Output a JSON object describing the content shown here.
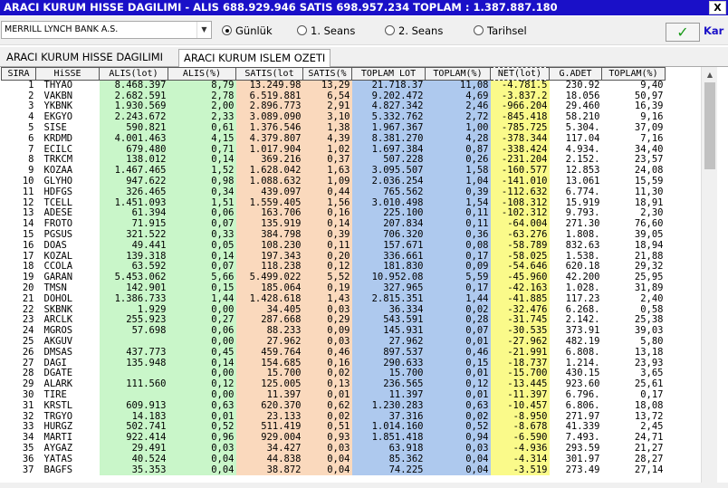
{
  "window": {
    "title": "ARACI KURUM HISSE DAGILIMI - ALIS 688.929.946  SATIS 698.957.234  TOPLAM : 1.387.887.180",
    "close_label": "X"
  },
  "toolbar": {
    "broker_value": "MERRILL LYNCH BANK A.S.",
    "radios": [
      {
        "label": "Günlük",
        "selected": true
      },
      {
        "label": "1. Seans",
        "selected": false
      },
      {
        "label": "2. Seans",
        "selected": false
      },
      {
        "label": "Tarihsel",
        "selected": false
      }
    ],
    "ok_label": "✓",
    "kar_label": "Kar"
  },
  "tabs": [
    {
      "label": "ARACI KURUM HISSE DAGILIMI",
      "active": false
    },
    {
      "label": "ARACI KURUM ISLEM OZETI",
      "active": true
    }
  ],
  "colors": {
    "titlebar": "#1a10c8",
    "alis": "#c9f6c9",
    "satis": "#fad9bd",
    "toplam": "#aec9ee",
    "net": "#fafa8a"
  },
  "table": {
    "columns": [
      "SIRA",
      "HiSSE",
      "ALIS(lot)",
      "ALIS(%)",
      "SATIS(lot",
      "SATIS(%",
      "TOPLAM LOT",
      "TOPLAM(%)",
      "NET(lot)",
      "G.ADET",
      "TOPLAM(%)"
    ],
    "rows": [
      [
        "1",
        "THYAO",
        "8.468.397",
        "8,79",
        "13.249.98",
        "13,29",
        "21.718.37",
        "11,08",
        "-4.781.5",
        "230.92",
        "9,40"
      ],
      [
        "2",
        "VAKBN",
        "2.682.591",
        "2,78",
        "6.519.881",
        "6,54",
        "9.202.472",
        "4,69",
        "-3.837.2",
        "18.056",
        "50,97"
      ],
      [
        "3",
        "YKBNK",
        "1.930.569",
        "2,00",
        "2.896.773",
        "2,91",
        "4.827.342",
        "2,46",
        "-966.204",
        "29.460",
        "16,39"
      ],
      [
        "4",
        "EKGYO",
        "2.243.672",
        "2,33",
        "3.089.090",
        "3,10",
        "5.332.762",
        "2,72",
        "-845.418",
        "58.210",
        "9,16"
      ],
      [
        "5",
        "SISE",
        "590.821",
        "0,61",
        "1.376.546",
        "1,38",
        "1.967.367",
        "1,00",
        "-785.725",
        "5.304.",
        "37,09"
      ],
      [
        "6",
        "KRDMD",
        "4.001.463",
        "4,15",
        "4.379.807",
        "4,39",
        "8.381.270",
        "4,28",
        "-378.344",
        "117.04",
        "7,16"
      ],
      [
        "7",
        "ECILC",
        "679.480",
        "0,71",
        "1.017.904",
        "1,02",
        "1.697.384",
        "0,87",
        "-338.424",
        "4.934.",
        "34,40"
      ],
      [
        "8",
        "TRKCM",
        "138.012",
        "0,14",
        "369.216",
        "0,37",
        "507.228",
        "0,26",
        "-231.204",
        "2.152.",
        "23,57"
      ],
      [
        "9",
        "KOZAA",
        "1.467.465",
        "1,52",
        "1.628.042",
        "1,63",
        "3.095.507",
        "1,58",
        "-160.577",
        "12.853",
        "24,08"
      ],
      [
        "10",
        "GLYHO",
        "947.622",
        "0,98",
        "1.088.632",
        "1,09",
        "2.036.254",
        "1,04",
        "-141.010",
        "13.061",
        "15,59"
      ],
      [
        "11",
        "HDFGS",
        "326.465",
        "0,34",
        "439.097",
        "0,44",
        "765.562",
        "0,39",
        "-112.632",
        "6.774.",
        "11,30"
      ],
      [
        "12",
        "TCELL",
        "1.451.093",
        "1,51",
        "1.559.405",
        "1,56",
        "3.010.498",
        "1,54",
        "-108.312",
        "15.919",
        "18,91"
      ],
      [
        "13",
        "ADESE",
        "61.394",
        "0,06",
        "163.706",
        "0,16",
        "225.100",
        "0,11",
        "-102.312",
        "9.793.",
        "2,30"
      ],
      [
        "14",
        "FROTO",
        "71.915",
        "0,07",
        "135.919",
        "0,14",
        "207.834",
        "0,11",
        "-64.004",
        "271.30",
        "76,60"
      ],
      [
        "15",
        "PGSUS",
        "321.522",
        "0,33",
        "384.798",
        "0,39",
        "706.320",
        "0,36",
        "-63.276",
        "1.808.",
        "39,05"
      ],
      [
        "16",
        "DOAS",
        "49.441",
        "0,05",
        "108.230",
        "0,11",
        "157.671",
        "0,08",
        "-58.789",
        "832.63",
        "18,94"
      ],
      [
        "17",
        "KOZAL",
        "139.318",
        "0,14",
        "197.343",
        "0,20",
        "336.661",
        "0,17",
        "-58.025",
        "1.538.",
        "21,88"
      ],
      [
        "18",
        "CCOLA",
        "63.592",
        "0,07",
        "118.238",
        "0,12",
        "181.830",
        "0,09",
        "-54.646",
        "620.18",
        "29,32"
      ],
      [
        "19",
        "GARAN",
        "5.453.062",
        "5,66",
        "5.499.022",
        "5,52",
        "10.952.08",
        "5,59",
        "-45.960",
        "42.200",
        "25,95"
      ],
      [
        "20",
        "TMSN",
        "142.901",
        "0,15",
        "185.064",
        "0,19",
        "327.965",
        "0,17",
        "-42.163",
        "1.028.",
        "31,89"
      ],
      [
        "21",
        "DOHOL",
        "1.386.733",
        "1,44",
        "1.428.618",
        "1,43",
        "2.815.351",
        "1,44",
        "-41.885",
        "117.23",
        "2,40"
      ],
      [
        "22",
        "SKBNK",
        "1.929",
        "0,00",
        "34.405",
        "0,03",
        "36.334",
        "0,02",
        "-32.476",
        "6.268.",
        "0,58"
      ],
      [
        "23",
        "ARCLK",
        "255.923",
        "0,27",
        "287.668",
        "0,29",
        "543.591",
        "0,28",
        "-31.745",
        "2.142.",
        "25,38"
      ],
      [
        "24",
        "MGROS",
        "57.698",
        "0,06",
        "88.233",
        "0,09",
        "145.931",
        "0,07",
        "-30.535",
        "373.91",
        "39,03"
      ],
      [
        "25",
        "AKGUV",
        "",
        "0,00",
        "27.962",
        "0,03",
        "27.962",
        "0,01",
        "-27.962",
        "482.19",
        "5,80"
      ],
      [
        "26",
        "DMSAS",
        "437.773",
        "0,45",
        "459.764",
        "0,46",
        "897.537",
        "0,46",
        "-21.991",
        "6.808.",
        "13,18"
      ],
      [
        "27",
        "DAGI",
        "135.948",
        "0,14",
        "154.685",
        "0,16",
        "290.633",
        "0,15",
        "-18.737",
        "1.214.",
        "23,93"
      ],
      [
        "28",
        "DGATE",
        "",
        "0,00",
        "15.700",
        "0,02",
        "15.700",
        "0,01",
        "-15.700",
        "430.15",
        "3,65"
      ],
      [
        "29",
        "ALARK",
        "111.560",
        "0,12",
        "125.005",
        "0,13",
        "236.565",
        "0,12",
        "-13.445",
        "923.60",
        "25,61"
      ],
      [
        "30",
        "TIRE",
        "",
        "0,00",
        "11.397",
        "0,01",
        "11.397",
        "0,01",
        "-11.397",
        "6.796.",
        "0,17"
      ],
      [
        "31",
        "KRSTL",
        "609.913",
        "0,63",
        "620.370",
        "0,62",
        "1.230.283",
        "0,63",
        "-10.457",
        "6.806.",
        "18,08"
      ],
      [
        "32",
        "TRGYO",
        "14.183",
        "0,01",
        "23.133",
        "0,02",
        "37.316",
        "0,02",
        "-8.950",
        "271.97",
        "13,72"
      ],
      [
        "33",
        "HURGZ",
        "502.741",
        "0,52",
        "511.419",
        "0,51",
        "1.014.160",
        "0,52",
        "-8.678",
        "41.339",
        "2,45"
      ],
      [
        "34",
        "MARTI",
        "922.414",
        "0,96",
        "929.004",
        "0,93",
        "1.851.418",
        "0,94",
        "-6.590",
        "7.493.",
        "24,71"
      ],
      [
        "35",
        "AYGAZ",
        "29.491",
        "0,03",
        "34.427",
        "0,03",
        "63.918",
        "0,03",
        "-4.936",
        "293.59",
        "21,27"
      ],
      [
        "36",
        "YATAS",
        "40.524",
        "0,04",
        "44.838",
        "0,04",
        "85.362",
        "0,04",
        "-4.314",
        "301.97",
        "28,27"
      ],
      [
        "37",
        "BAGFS",
        "35.353",
        "0,04",
        "38.872",
        "0,04",
        "74.225",
        "0,04",
        "-3.519",
        "273.49",
        "27,14"
      ]
    ]
  }
}
